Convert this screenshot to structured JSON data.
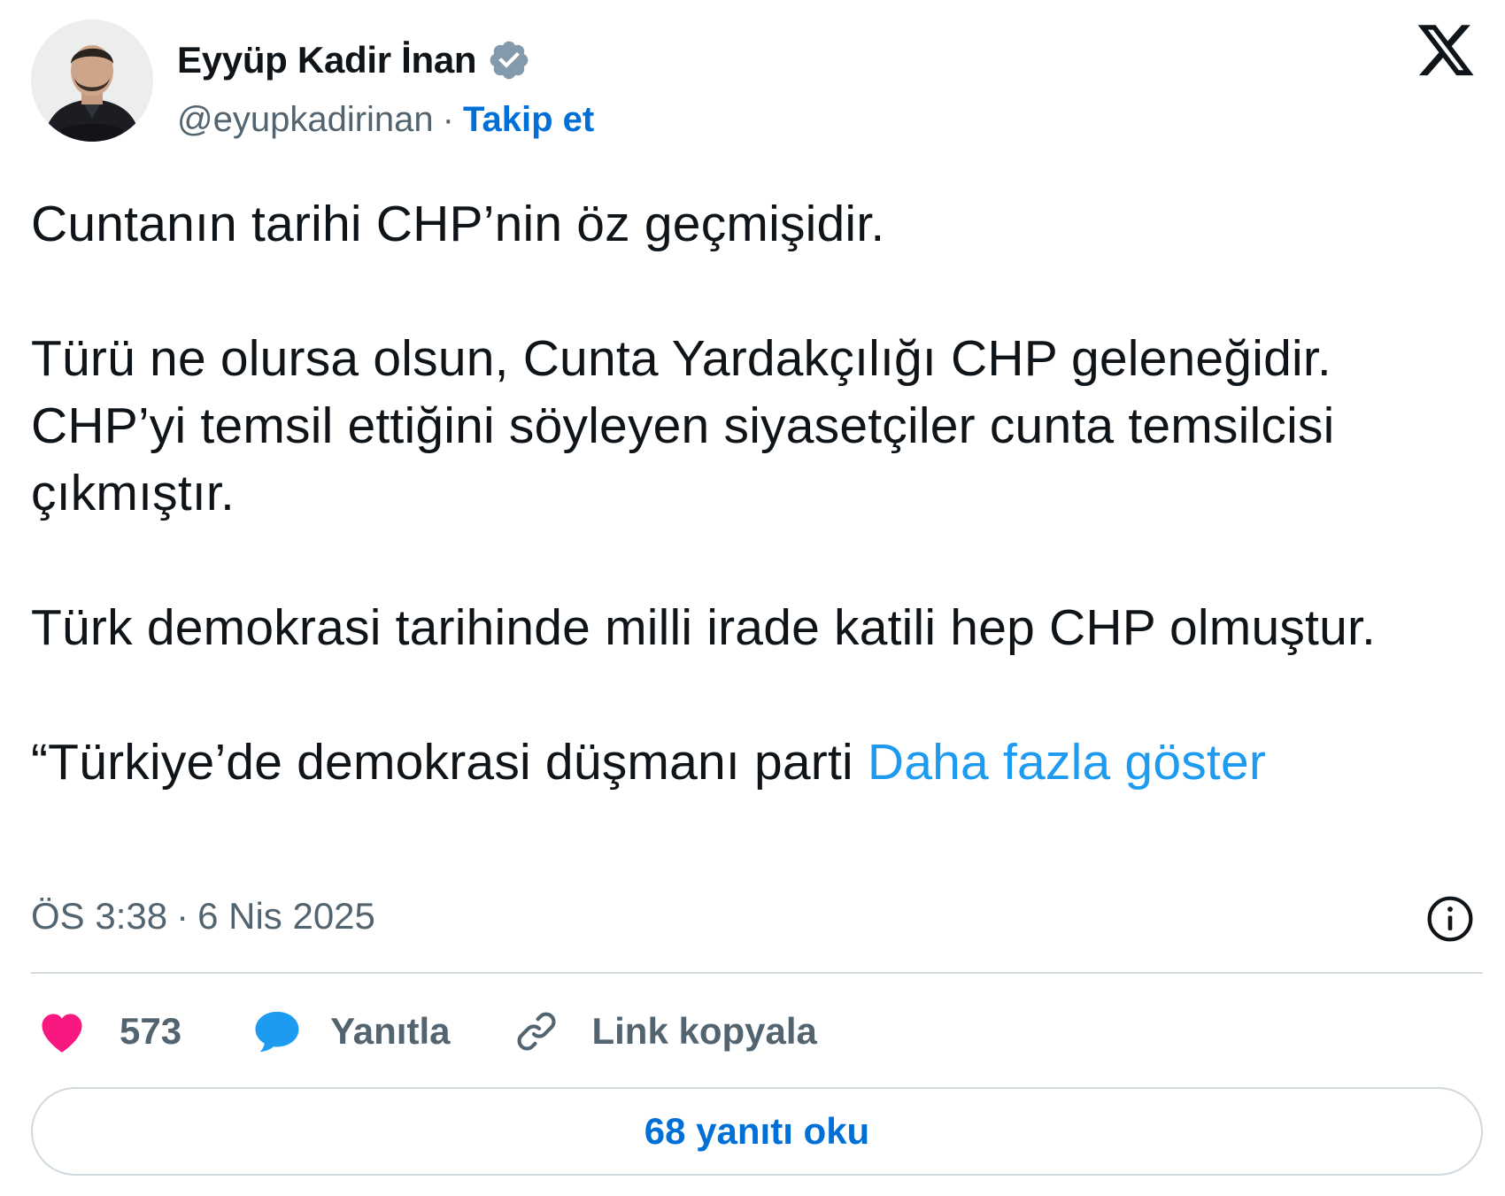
{
  "author": {
    "display_name": "Eyyüp Kadir İnan",
    "handle": "@eyupkadirinan",
    "separator": "·",
    "follow_label": "Takip et",
    "verified": true
  },
  "tweet": {
    "paragraphs": [
      "Cuntanın tarihi CHP’nin öz geçmişidir.",
      "Türü ne olursa olsun, Cunta Yardakçılığı CHP geleneğidir. CHP’yi temsil ettiğini söyleyen siyasetçiler cunta temsilcisi çıkmıştır.",
      "Türk demokrasi tarihinde milli irade katili hep CHP olmuştur.",
      "“Türkiye’de demokrasi düşmanı parti "
    ],
    "show_more_label": "Daha fazla göster"
  },
  "meta": {
    "time": "ÖS 3:38",
    "separator": "·",
    "date": "6 Nis 2025"
  },
  "actions": {
    "like_count": "573",
    "reply_label": "Yanıtla",
    "copy_link_label": "Link kopyala"
  },
  "read_replies_label": "68 yanıtı oku",
  "colors": {
    "text": "#0f1419",
    "secondary": "#536471",
    "link": "#1d9bf0",
    "follow": "#006fd6",
    "like": "#f91880",
    "reply_icon": "#1d9bf0",
    "verified_badge": "#829aab",
    "border": "#cfd9de"
  },
  "icons": {
    "brand": "x-logo-icon",
    "verified": "verified-badge-icon",
    "info": "info-icon",
    "like": "heart-icon",
    "reply": "speech-bubble-icon",
    "copy_link": "link-icon"
  }
}
